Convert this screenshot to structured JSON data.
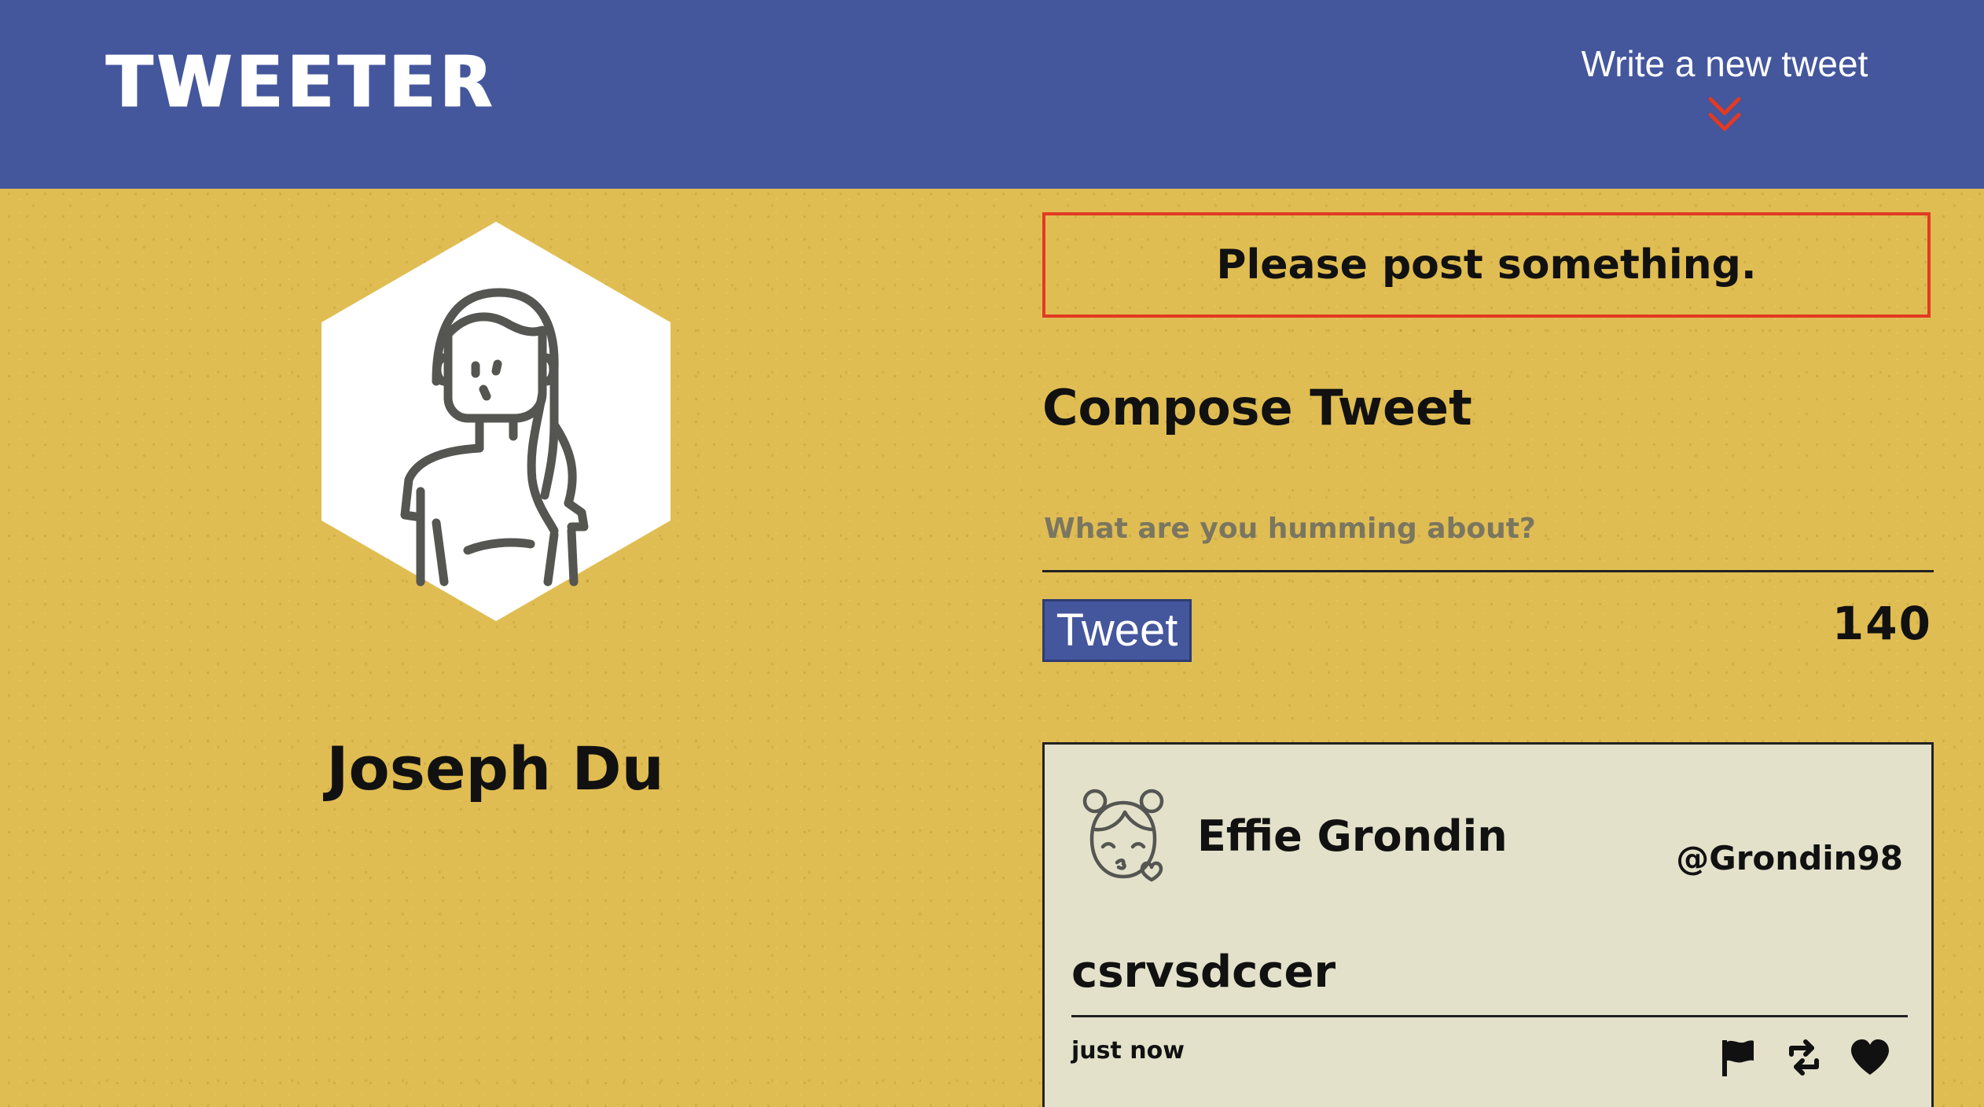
{
  "nav": {
    "logo": "TWEETER",
    "write_new_label": "Write a new tweet",
    "chevron_icon": "double-chevron-down-icon",
    "background_color": "#44569c",
    "accent_color": "#e23a23"
  },
  "profile": {
    "avatar_icon": "woman-avatar-icon",
    "name": "Joseph Du"
  },
  "compose": {
    "error_message": "Please post something.",
    "title": "Compose Tweet",
    "placeholder": "What are you humming about?",
    "value": "",
    "submit_label": "Tweet",
    "char_counter": "140"
  },
  "tweets": [
    {
      "avatar_icon": "girl-blowing-kiss-icon",
      "name": "Effie Grondin",
      "handle": "@Grondin98",
      "content": "csrvsdccer",
      "time": "just now",
      "actions": [
        "flag-icon",
        "retweet-icon",
        "heart-icon"
      ]
    }
  ],
  "colors": {
    "page_background": "#e0bd52",
    "card_background": "#e3e1ca",
    "button_background": "#44569c",
    "error_border": "#e23a23"
  }
}
